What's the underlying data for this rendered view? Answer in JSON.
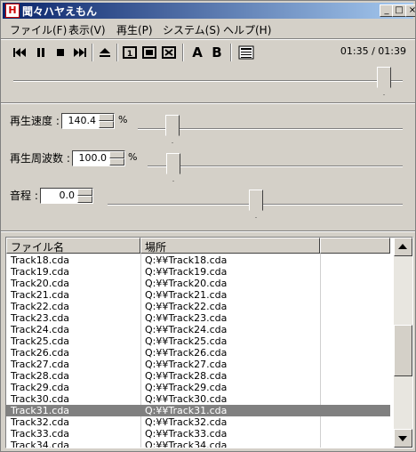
{
  "window": {
    "title": "聞々ハヤえもん",
    "app_icon_glyph": "H"
  },
  "caption_buttons": {
    "minimize": "_",
    "maximize": "□",
    "close": "×"
  },
  "menu": [
    {
      "label": "ファイル(F)"
    },
    {
      "label": "表示(V)"
    },
    {
      "label": "再生(P)"
    },
    {
      "label": "システム(S)"
    },
    {
      "label": "ヘルプ(H)"
    }
  ],
  "toolbar": {
    "icons": [
      "previous-icon",
      "pause-icon",
      "stop-icon",
      "next-icon",
      "eject-icon",
      "repeat-one-icon",
      "repeat-all-icon",
      "shuffle-icon",
      "ab-a-icon",
      "ab-b-icon",
      "playlist-icon"
    ],
    "a_label": "A",
    "b_label": "B",
    "time": "01:35 / 01:39",
    "position_fraction": 0.96
  },
  "controls": {
    "speed": {
      "label": "再生速度 :",
      "value": "140.4",
      "unit": "%",
      "slider_fraction": 0.13
    },
    "frequency": {
      "label": "再生周波数 :",
      "value": "100.0",
      "unit": "%",
      "slider_fraction": 0.1
    },
    "pitch": {
      "label": "音程 :",
      "value": "0.0",
      "slider_fraction": 0.5
    }
  },
  "playlist": {
    "columns": [
      "ファイル名",
      "場所",
      ""
    ],
    "rows": [
      {
        "name": "Track18.cda",
        "path": "Q:¥¥Track18.cda"
      },
      {
        "name": "Track19.cda",
        "path": "Q:¥¥Track19.cda"
      },
      {
        "name": "Track20.cda",
        "path": "Q:¥¥Track20.cda"
      },
      {
        "name": "Track21.cda",
        "path": "Q:¥¥Track21.cda"
      },
      {
        "name": "Track22.cda",
        "path": "Q:¥¥Track22.cda"
      },
      {
        "name": "Track23.cda",
        "path": "Q:¥¥Track23.cda"
      },
      {
        "name": "Track24.cda",
        "path": "Q:¥¥Track24.cda"
      },
      {
        "name": "Track25.cda",
        "path": "Q:¥¥Track25.cda"
      },
      {
        "name": "Track26.cda",
        "path": "Q:¥¥Track26.cda"
      },
      {
        "name": "Track27.cda",
        "path": "Q:¥¥Track27.cda"
      },
      {
        "name": "Track28.cda",
        "path": "Q:¥¥Track28.cda"
      },
      {
        "name": "Track29.cda",
        "path": "Q:¥¥Track29.cda"
      },
      {
        "name": "Track30.cda",
        "path": "Q:¥¥Track30.cda"
      },
      {
        "name": "Track31.cda",
        "path": "Q:¥¥Track31.cda",
        "selected": true
      },
      {
        "name": "Track32.cda",
        "path": "Q:¥¥Track32.cda"
      },
      {
        "name": "Track33.cda",
        "path": "Q:¥¥Track33.cda"
      },
      {
        "name": "Track34.cda",
        "path": "Q:¥¥Track34.cda"
      }
    ]
  },
  "colors": {
    "title_start": "#0a246a",
    "title_end": "#a6caf0",
    "face": "#d4d0c8",
    "selection": "#808080"
  }
}
